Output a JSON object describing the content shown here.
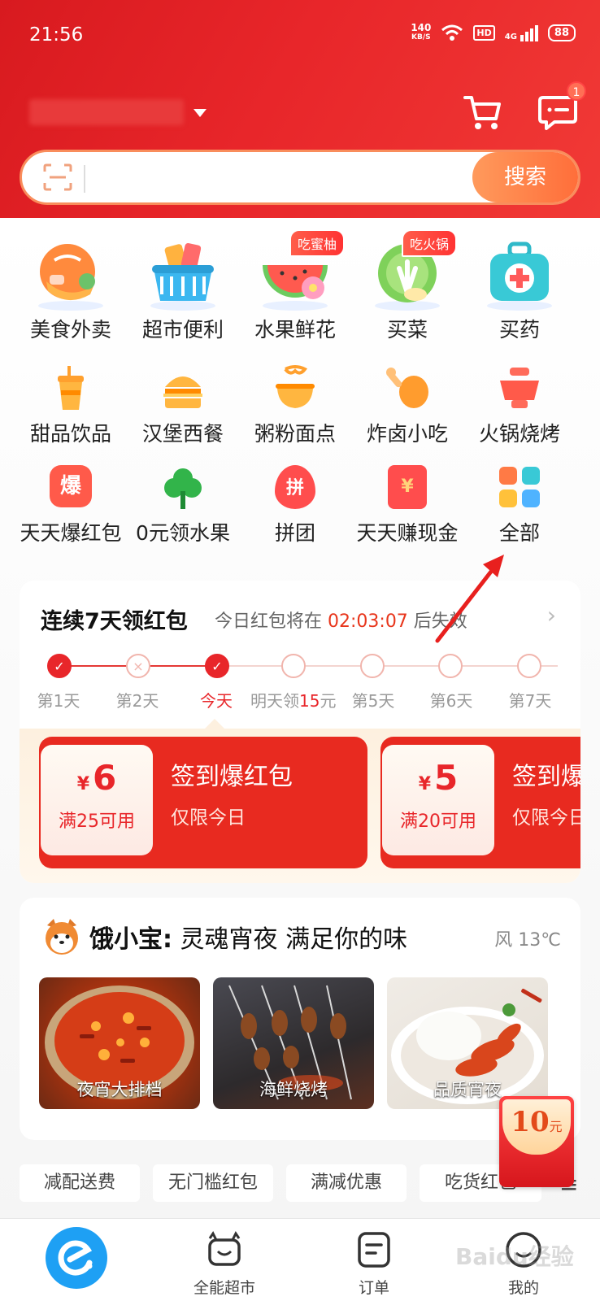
{
  "status_bar": {
    "time": "21:56",
    "net_speed": "140",
    "net_unit": "KB/S",
    "hd": "HD",
    "signal": "4G",
    "battery": "88"
  },
  "header": {
    "message_badge": "1"
  },
  "search": {
    "button": "搜索",
    "placeholder": ""
  },
  "categories_row1": [
    {
      "label": "美食外卖",
      "icon": "food-delivery-icon",
      "tag": ""
    },
    {
      "label": "超市便利",
      "icon": "supermarket-basket-icon",
      "tag": ""
    },
    {
      "label": "水果鲜花",
      "icon": "fruit-flower-icon",
      "tag": "吃蜜柚"
    },
    {
      "label": "买菜",
      "icon": "vegetable-icon",
      "tag": "吃火锅"
    },
    {
      "label": "买药",
      "icon": "medicine-box-icon",
      "tag": ""
    }
  ],
  "categories_row2": [
    {
      "label": "甜品饮品",
      "icon": "drink-cup-icon"
    },
    {
      "label": "汉堡西餐",
      "icon": "burger-icon"
    },
    {
      "label": "粥粉面点",
      "icon": "noodle-bowl-icon"
    },
    {
      "label": "炸卤小吃",
      "icon": "drumstick-icon"
    },
    {
      "label": "火锅烧烤",
      "icon": "hotpot-icon"
    }
  ],
  "categories_row3": [
    {
      "label": "天天爆红包",
      "icon": "red-packet-icon",
      "glyph": "爆"
    },
    {
      "label": "0元领水果",
      "icon": "tree-icon",
      "glyph": ""
    },
    {
      "label": "拼团",
      "icon": "group-buy-flame-icon",
      "glyph": "拼"
    },
    {
      "label": "天天赚现金",
      "icon": "cash-envelope-icon",
      "glyph": "¥"
    },
    {
      "label": "全部",
      "icon": "all-grid-icon",
      "glyph": ""
    }
  ],
  "checkin": {
    "title": "连续7天领红包",
    "sub_prefix": "今日红包将在 ",
    "countdown": "02:03:07",
    "sub_suffix": " 后失效",
    "days": [
      "第1天",
      "第2天",
      "今天",
      "明天领",
      "第5天",
      "第6天",
      "第7天"
    ],
    "tomorrow_amount": "15",
    "tomorrow_unit": "元",
    "coupons": [
      {
        "currency": "¥",
        "amount": "6",
        "condition": "满25可用",
        "name": "签到爆红包",
        "note": "仅限今日"
      },
      {
        "currency": "¥",
        "amount": "5",
        "condition": "满20可用",
        "name": "签到爆红包",
        "note": "仅限今日"
      }
    ]
  },
  "night": {
    "brand": "饿小宝:",
    "title": " 灵魂宵夜 满足你的味",
    "weather": "风 13℃",
    "photos": [
      "夜宵大排档",
      "海鲜烧烤",
      "品质宵夜"
    ]
  },
  "filters": [
    "减配送费",
    "无门槛红包",
    "满减优惠",
    "吃货红包"
  ],
  "float_packet": {
    "amount": "10",
    "unit": "元"
  },
  "nav": [
    "全能超市",
    "订单",
    "我的"
  ],
  "watermark": "Baidu经验",
  "colors": {
    "brand_red": "#e8262a",
    "accent_orange": "#ff7a45",
    "home_blue": "#1ea0f4"
  }
}
